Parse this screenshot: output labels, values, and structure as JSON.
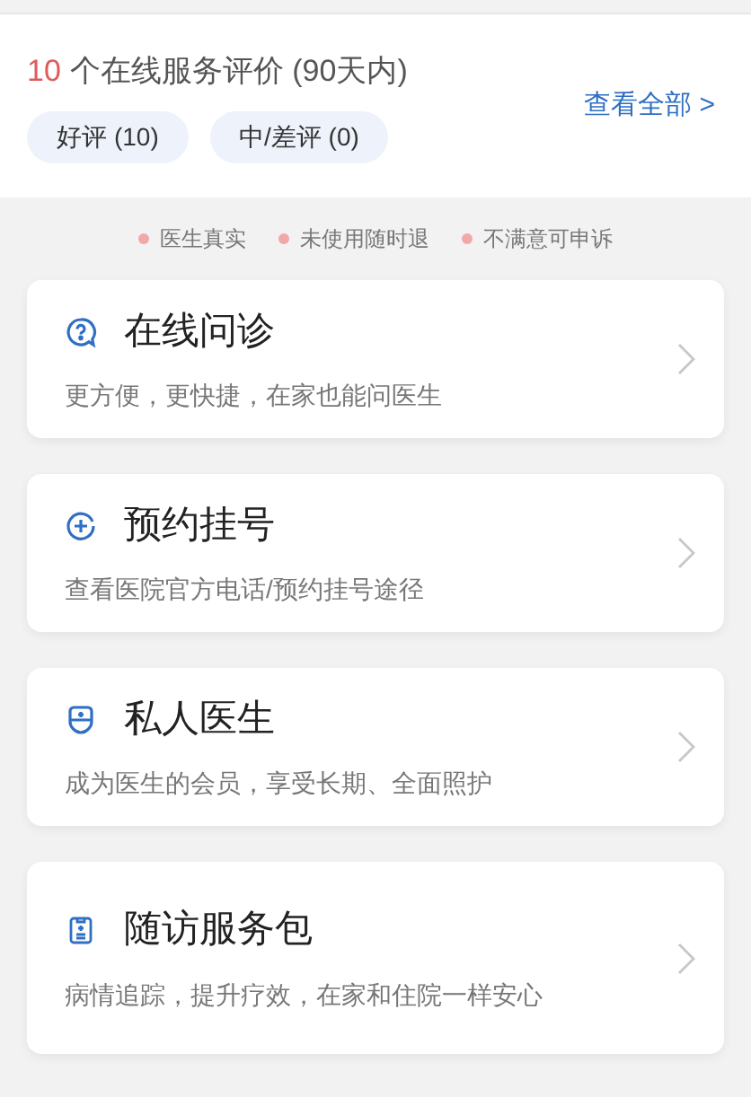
{
  "reviews": {
    "count": "10",
    "label": "个在线服务评价 (90天内)",
    "view_all": "查看全部 >",
    "filters": [
      {
        "label": "好评 (10)"
      },
      {
        "label": "中/差评 (0)"
      }
    ]
  },
  "guarantees": [
    "医生真实",
    "未使用随时退",
    "不满意可申诉"
  ],
  "services": [
    {
      "kind": "question",
      "title": "在线问诊",
      "subtitle": "更方便，更快捷，在家也能问医生"
    },
    {
      "kind": "plus",
      "title": "预约挂号",
      "subtitle": "查看医院官方电话/预约挂号途径"
    },
    {
      "kind": "badge",
      "title": "私人医生",
      "subtitle": "成为医生的会员，享受长期、全面照护"
    },
    {
      "kind": "clipboard",
      "title": "随访服务包",
      "subtitle": "病情追踪，提升疗效，在家和住院一样安心"
    }
  ]
}
